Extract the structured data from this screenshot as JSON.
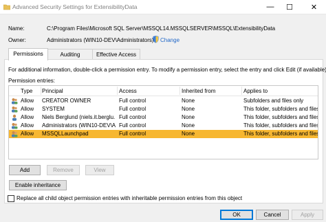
{
  "window": {
    "title": "Advanced Security Settings for ExtensibilityData",
    "controls": {
      "minimize": "—",
      "maximize": "☐",
      "close": "✕"
    }
  },
  "object": {
    "name_label": "Name:",
    "name_value": "C:\\Program Files\\Microsoft SQL Server\\MSSQL14.MSSQLSERVER\\MSSQL\\ExtensibilityData",
    "owner_label": "Owner:",
    "owner_value": "Administrators (WIN10-DEV\\Administrators)",
    "change_link": "Change"
  },
  "tabs": [
    {
      "label": "Permissions",
      "active": true
    },
    {
      "label": "Auditing",
      "active": false
    },
    {
      "label": "Effective Access",
      "active": false
    }
  ],
  "permissions": {
    "info_text": "For additional information, double-click a permission entry. To modify a permission entry, select the entry and click Edit (if available).",
    "entries_label": "Permission entries:",
    "columns": [
      "Type",
      "Principal",
      "Access",
      "Inherited from",
      "Applies to"
    ],
    "rows": [
      {
        "type": "Allow",
        "principal": "CREATOR OWNER",
        "access": "Full control",
        "inherited": "None",
        "applies": "Subfolders and files only",
        "selected": false
      },
      {
        "type": "Allow",
        "principal": "SYSTEM",
        "access": "Full control",
        "inherited": "None",
        "applies": "This folder, subfolders and files",
        "selected": false
      },
      {
        "type": "Allow",
        "principal": "Niels Berglund (niels.it.berglu...",
        "access": "Full control",
        "inherited": "None",
        "applies": "This folder, subfolders and files",
        "selected": false
      },
      {
        "type": "Allow",
        "principal": "Administrators (WIN10-DEV\\Ad...",
        "access": "Full control",
        "inherited": "None",
        "applies": "This folder, subfolders and files",
        "selected": false
      },
      {
        "type": "Allow",
        "principal": "MSSQLLaunchpad",
        "access": "Full control",
        "inherited": "None",
        "applies": "This folder, subfolders and files",
        "selected": true
      }
    ]
  },
  "buttons": {
    "add": "Add",
    "remove": "Remove",
    "view": "View",
    "enable_inheritance": "Enable inheritance",
    "ok": "OK",
    "cancel": "Cancel",
    "apply": "Apply"
  },
  "replace_checkbox": {
    "label": "Replace all child object permission entries with inheritable permission entries from this object",
    "checked": false
  },
  "colors": {
    "selected_row": "#f7b731",
    "link": "#1f66c7"
  }
}
